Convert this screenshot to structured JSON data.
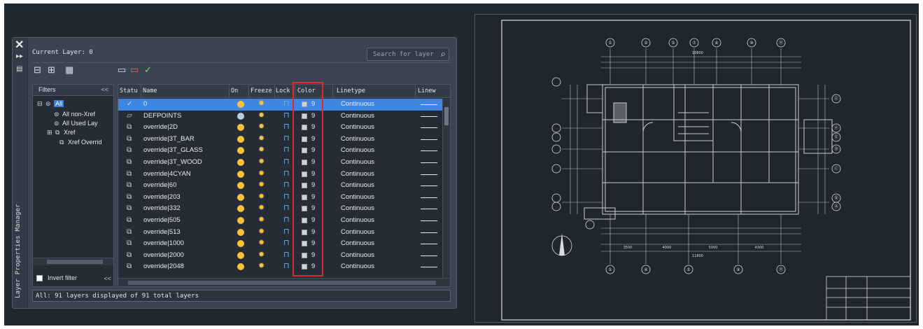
{
  "palette": {
    "title": "Layer Properties Manager",
    "current_layer": "Current Layer: 0",
    "search_placeholder": "Search for layer",
    "filters_header": "Filters",
    "collapse_label": "<<",
    "filter_tree": [
      {
        "label": "All",
        "selected": true
      },
      {
        "label": "All non-Xref"
      },
      {
        "label": "All Used Lay"
      },
      {
        "label": "Xref"
      },
      {
        "label": "Xref Overrid"
      }
    ],
    "invert_filter_label": "Invert filter",
    "status_text": "All: 91 layers displayed of 91 total layers"
  },
  "table": {
    "columns": [
      "Statu",
      "Name",
      "On",
      "Freeze",
      "Lock",
      "Color",
      "Linetype",
      "Linew"
    ],
    "rows": [
      {
        "name": "0",
        "color": "9",
        "linetype": "Continuous",
        "on": true,
        "selected": true,
        "status": "current-check"
      },
      {
        "name": "DEFPOINTS",
        "color": "9",
        "linetype": "Continuous",
        "on": false,
        "status": "layer"
      },
      {
        "name": "override|2D",
        "color": "9",
        "linetype": "Continuous",
        "on": true,
        "status": "override"
      },
      {
        "name": "override|3T_BAR",
        "color": "9",
        "linetype": "Continuous",
        "on": true,
        "status": "override"
      },
      {
        "name": "override|3T_GLASS",
        "color": "9",
        "linetype": "Continuous",
        "on": true,
        "status": "override"
      },
      {
        "name": "override|3T_WOOD",
        "color": "9",
        "linetype": "Continuous",
        "on": true,
        "status": "override"
      },
      {
        "name": "override|4CYAN",
        "color": "9",
        "linetype": "Continuous",
        "on": true,
        "status": "override"
      },
      {
        "name": "override|60",
        "color": "9",
        "linetype": "Continuous",
        "on": true,
        "status": "override"
      },
      {
        "name": "override|203",
        "color": "9",
        "linetype": "Continuous",
        "on": true,
        "status": "override"
      },
      {
        "name": "override|332",
        "color": "9",
        "linetype": "Continuous",
        "on": true,
        "status": "override"
      },
      {
        "name": "override|505",
        "color": "9",
        "linetype": "Continuous",
        "on": true,
        "status": "override"
      },
      {
        "name": "override|513",
        "color": "9",
        "linetype": "Continuous",
        "on": true,
        "status": "override"
      },
      {
        "name": "override|1000",
        "color": "9",
        "linetype": "Continuous",
        "on": true,
        "status": "override"
      },
      {
        "name": "override|2000",
        "color": "9",
        "linetype": "Continuous",
        "on": true,
        "status": "override"
      },
      {
        "name": "override|2048",
        "color": "9",
        "linetype": "Continuous",
        "on": true,
        "status": "override"
      }
    ]
  },
  "drawing": {
    "top_axis_labels": [
      "①",
      "③",
      "⑤",
      "⑦",
      "⑧",
      "⑩",
      "⑪"
    ],
    "bottom_axis_labels": [
      "①",
      "④",
      "⑤",
      "⑨",
      "⑪"
    ],
    "right_axis_labels": [
      "Ⓖ",
      "Ⓕ",
      "Ⓔ",
      "Ⓓ",
      "Ⓒ",
      "Ⓑ",
      "Ⓐ"
    ],
    "dim_top": "10800",
    "dim_bottom": "11800",
    "dim_bottom_segments": [
      "3500",
      "4000",
      "5000",
      "4300"
    ]
  },
  "colors": {
    "accent": "#3f86e2",
    "panel_bg": "#3b4452",
    "app_bg": "#212830",
    "highlight_box": "#e0292b"
  }
}
